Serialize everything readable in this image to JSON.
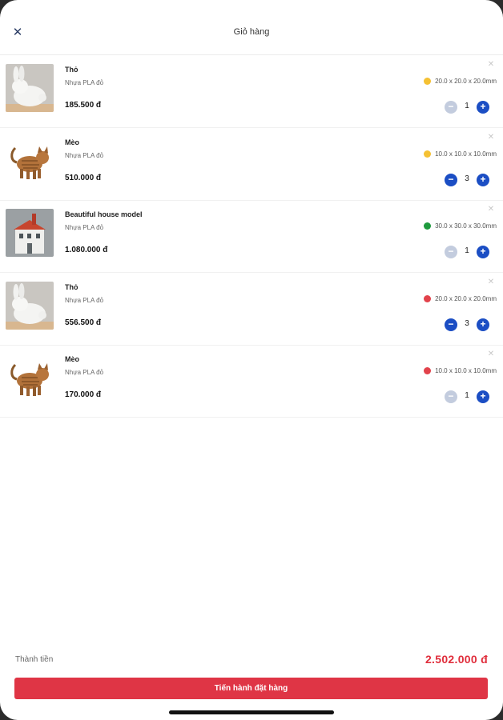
{
  "header": {
    "title": "Giỏ hàng",
    "close_icon": "close-icon"
  },
  "colors": {
    "accent_blue": "#1b4ec4",
    "accent_blue_disabled": "#c3ccde",
    "checkout_red": "#df3545",
    "total_red": "#e02e3c"
  },
  "items": [
    {
      "name": "Thỏ",
      "material": "Nhựa PLA đỏ",
      "size": "20.0 x 20.0 x 20.0mm",
      "color": "#f5c133",
      "price": "185.500 đ",
      "quantity": "1",
      "minus_enabled": false,
      "image": "bunny"
    },
    {
      "name": "Mèo",
      "material": "Nhựa PLA đỏ",
      "size": "10.0 x 10.0 x 10.0mm",
      "color": "#f5c133",
      "price": "510.000 đ",
      "quantity": "3",
      "minus_enabled": true,
      "image": "cat"
    },
    {
      "name": "Beautiful house model",
      "material": "Nhựa PLA đỏ",
      "size": "30.0 x 30.0 x 30.0mm",
      "color": "#1e9a3d",
      "price": "1.080.000 đ",
      "quantity": "1",
      "minus_enabled": false,
      "image": "house"
    },
    {
      "name": "Thỏ",
      "material": "Nhựa PLA đỏ",
      "size": "20.0 x 20.0 x 20.0mm",
      "color": "#e2424b",
      "price": "556.500 đ",
      "quantity": "3",
      "minus_enabled": true,
      "image": "bunny"
    },
    {
      "name": "Mèo",
      "material": "Nhựa PLA đỏ",
      "size": "10.0 x 10.0 x 10.0mm",
      "color": "#e2424b",
      "price": "170.000 đ",
      "quantity": "1",
      "minus_enabled": false,
      "image": "cat"
    }
  ],
  "summary": {
    "total_label": "Thành tiền",
    "total_value": "2.502.000 đ"
  },
  "checkout": {
    "label": "Tiến hành đặt hàng"
  }
}
